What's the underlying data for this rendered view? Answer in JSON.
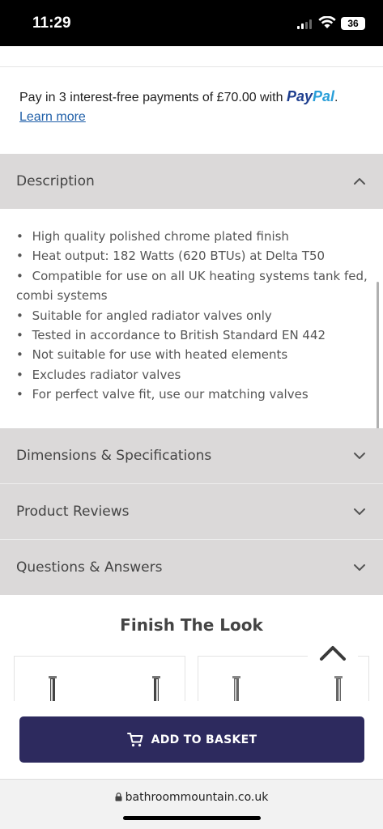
{
  "status_bar": {
    "time": "11:29",
    "battery": "36"
  },
  "paypal": {
    "text": "Pay in 3 interest-free payments of £70.00 with ",
    "logo_part1": "Pay",
    "logo_part2": "Pal",
    "period": ".",
    "learn_more": "Learn more"
  },
  "accordions": {
    "description": {
      "title": "Description",
      "state": "expanded"
    },
    "dimensions": {
      "title": "Dimensions & Specifications",
      "state": "collapsed"
    },
    "reviews": {
      "title": "Product Reviews",
      "state": "collapsed"
    },
    "qa": {
      "title": "Questions & Answers",
      "state": "collapsed"
    }
  },
  "description_items": [
    "High quality polished chrome plated finish",
    "Heat output: 182 Watts (620 BTUs) at Delta T50",
    "Compatible for use on all UK heating systems tank fed, combi systems",
    "Suitable for angled radiator valves only",
    "Tested in accordance to British Standard EN 442",
    "Not suitable for use with heated elements",
    "Excludes radiator valves",
    "For perfect valve fit, use our matching valves"
  ],
  "bullet": "•",
  "finish_the_look": {
    "title": "Finish The Look"
  },
  "basket": {
    "label": "ADD TO BASKET",
    "icon": "cart-icon"
  },
  "browser": {
    "url": "bathroommountain.co.uk",
    "icon": "lock-icon"
  },
  "colors": {
    "accordion_bg": "#dbd9d9",
    "button_bg": "#2d2a5e",
    "paypal_dark": "#1f3f8f",
    "paypal_light": "#2a9fd9",
    "link": "#1f5fa8"
  }
}
